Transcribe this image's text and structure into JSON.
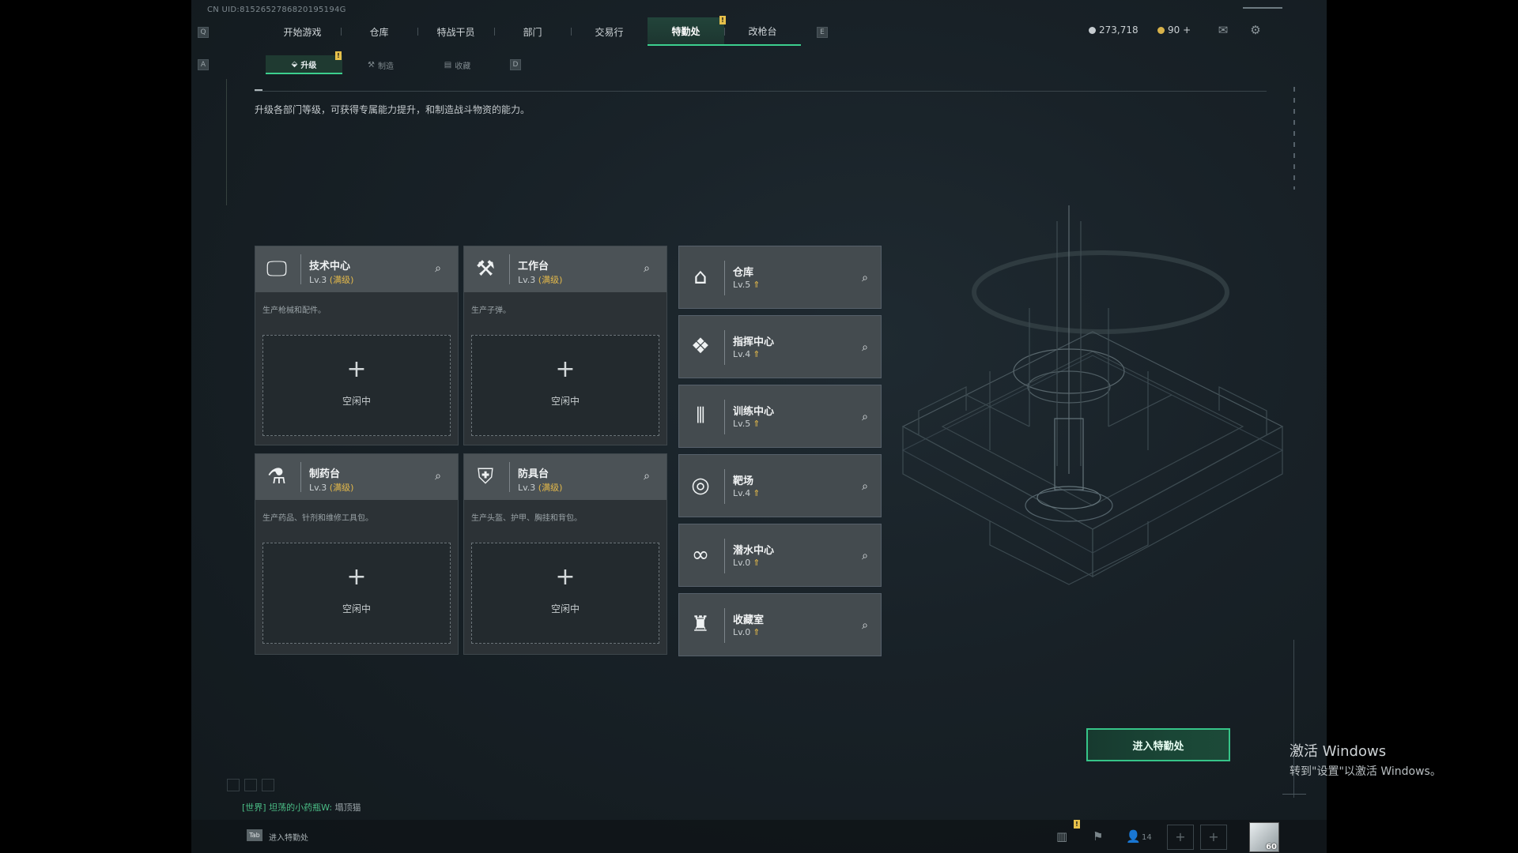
{
  "uid": "CN UID:8152652786820195194G",
  "nav": {
    "left_key": "Q",
    "right_key": "E",
    "tabs": [
      "开始游戏",
      "仓库",
      "特战干员",
      "部门",
      "交易行",
      "特勤处",
      "改枪台"
    ],
    "active_tab": "特勤处",
    "badge": "!"
  },
  "currency": {
    "coins": "273,718",
    "tickets": "90 +",
    "coin_color": "#c6ccd0",
    "ticket_color": "#d8b24a"
  },
  "icons": {
    "mail": "mail-icon",
    "settings": "gear-icon"
  },
  "sub_nav": {
    "left_key": "A",
    "right_key": "D",
    "tabs": [
      "升级",
      "制造",
      "收藏"
    ],
    "active_tab": "升级",
    "badge": "!"
  },
  "description": "升级各部门等级，可获得专属能力提升，和制造战斗物资的能力。",
  "production_cards": [
    {
      "name": "技术中心",
      "level": "Lv.3",
      "status": "(满级)",
      "desc": "生产枪械和配件。",
      "slot_label": "空闲中",
      "icon": "monitor-icon"
    },
    {
      "name": "工作台",
      "level": "Lv.3",
      "status": "(满级)",
      "desc": "生产子弹。",
      "slot_label": "空闲中",
      "icon": "tools-icon"
    },
    {
      "name": "制药台",
      "level": "Lv.3",
      "status": "(满级)",
      "desc": "生产药品、针剂和维修工具包。",
      "slot_label": "空闲中",
      "icon": "microscope-icon"
    },
    {
      "name": "防具台",
      "level": "Lv.3",
      "status": "(满级)",
      "desc": "生产头盔、护甲、胸挂和背包。",
      "slot_label": "空闲中",
      "icon": "armor-icon"
    }
  ],
  "facilities": [
    {
      "name": "仓库",
      "level": "Lv.5",
      "icon": "warehouse-icon"
    },
    {
      "name": "指挥中心",
      "level": "Lv.4",
      "icon": "command-icon"
    },
    {
      "name": "训练中心",
      "level": "Lv.5",
      "icon": "dumbbell-icon"
    },
    {
      "name": "靶场",
      "level": "Lv.4",
      "icon": "target-icon"
    },
    {
      "name": "潜水中心",
      "level": "Lv.0",
      "icon": "diving-mask-icon"
    },
    {
      "name": "收藏室",
      "level": "Lv.0",
      "icon": "trophy-icon"
    }
  ],
  "enter_button": "进入特勤处",
  "chat": {
    "channel": "[世界]",
    "user": "坦荡的小药瓶W:",
    "message": "塌顶猫"
  },
  "bottom": {
    "tab_key": "Tab",
    "tab_label": "进入特勤处",
    "friends_count": "14",
    "badge": "!",
    "avatar_level": "60"
  },
  "watermark": {
    "title": "激活 Windows",
    "subtitle": "转到\"设置\"以激活 Windows。"
  }
}
